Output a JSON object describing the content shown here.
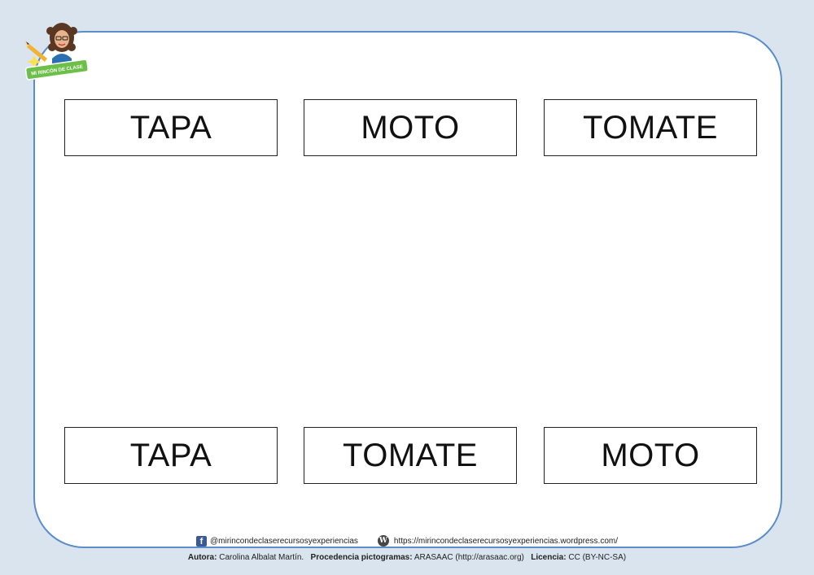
{
  "logo": {
    "text": "MI RINCÓN DE CLASE"
  },
  "top_row": [
    {
      "label": "TAPA"
    },
    {
      "label": "MOTO"
    },
    {
      "label": "TOMATE"
    }
  ],
  "bottom_row": [
    {
      "label": "TAPA"
    },
    {
      "label": "TOMATE"
    },
    {
      "label": "MOTO"
    }
  ],
  "footer": {
    "facebook_handle": "@mirincondeclaserecursosyexperiencias",
    "website": "https://mirincondeclaserecursosyexperiencias.wordpress.com/",
    "author_label": "Autora:",
    "author_value": "Carolina Albalat Martín.",
    "pictos_label": "Procedencia pictogramas:",
    "pictos_value": "ARASAAC (http://arasaac.org)",
    "license_label": "Licencia:",
    "license_value": "CC (BY-NC-SA)"
  },
  "colors": {
    "background": "#dae4ef",
    "border": "#5b8dc9",
    "logo_badge": "#6cc04a",
    "facebook": "#3b5998"
  }
}
